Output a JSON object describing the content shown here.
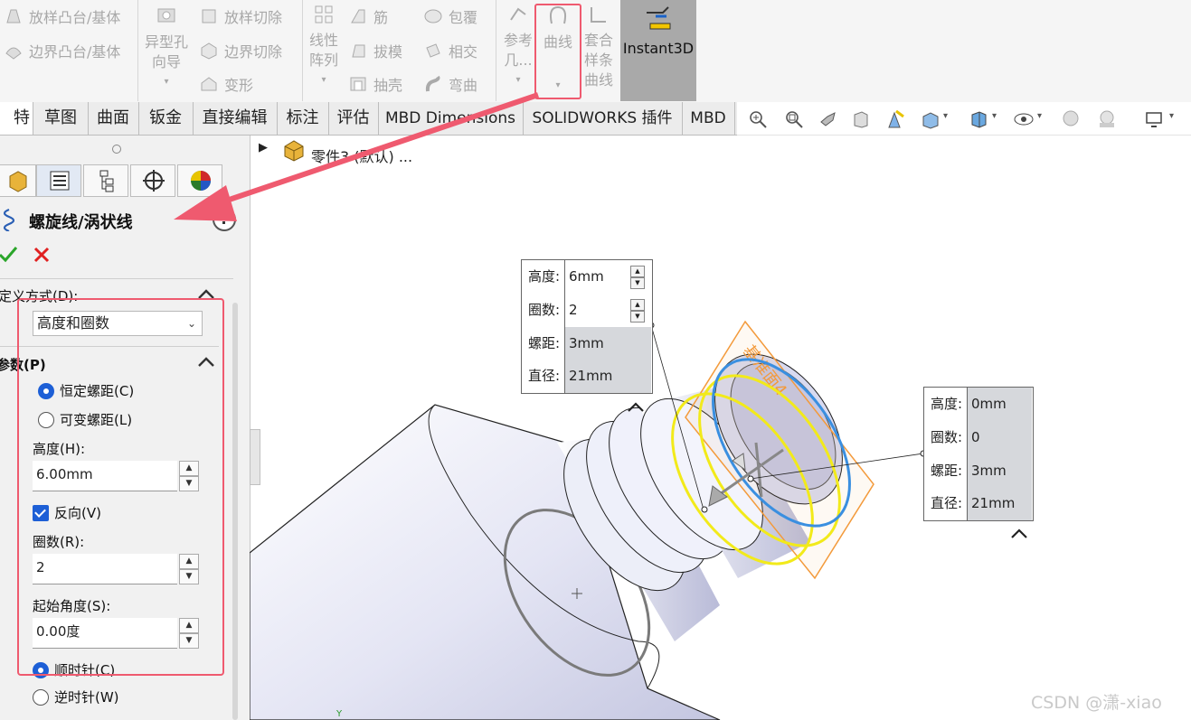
{
  "ribbon": {
    "loft_boss": "放样凸台/基体",
    "boundary_boss": "边界凸台/基体",
    "hole_wizard": [
      "异型孔",
      "向导"
    ],
    "loft_cut": "放样切除",
    "boundary_cut": "边界切除",
    "deform": "变形",
    "linear_pattern": [
      "线性",
      "阵列"
    ],
    "rib": "筋",
    "draft": "拔模",
    "shell": "抽壳",
    "wrap": "包覆",
    "intersect": "相交",
    "flex": "弯曲",
    "reference": [
      "参考",
      "几..."
    ],
    "curves": "曲线",
    "fit_spline": [
      "套合",
      "样条",
      "曲线"
    ],
    "instant3d": "Instant3D"
  },
  "tabs": [
    "特征",
    "草图",
    "曲面",
    "钣金",
    "直接编辑",
    "标注",
    "评估",
    "MBD Dimensions",
    "SOLIDWORKS 插件",
    "MBD"
  ],
  "tree_item": "零件3 (默认) ...",
  "panel": {
    "title": "螺旋线/涡状线",
    "help": "?",
    "define_by_label": "定义方式(D):",
    "define_by_value": "高度和圈数",
    "params_label": "参数(P)",
    "constant_pitch": "恒定螺距(C)",
    "variable_pitch": "可变螺距(L)",
    "height_label": "高度(H):",
    "height_value": "6.00mm",
    "reverse": "反向(V)",
    "revolutions_label": "圈数(R):",
    "revolutions_value": "2",
    "start_angle_label": "起始角度(S):",
    "start_angle_value": "0.00度",
    "clockwise": "顺时针(C)",
    "counterclockwise": "逆时针(W)"
  },
  "callout_left": {
    "rows": [
      {
        "label": "高度:",
        "value": "6mm"
      },
      {
        "label": "圈数:",
        "value": "2"
      },
      {
        "label": "螺距:",
        "value": "3mm"
      },
      {
        "label": "直径:",
        "value": "21mm"
      }
    ]
  },
  "callout_right": {
    "rows": [
      {
        "label": "高度:",
        "value": "0mm"
      },
      {
        "label": "圈数:",
        "value": "0"
      },
      {
        "label": "螺距:",
        "value": "3mm"
      },
      {
        "label": "直径:",
        "value": "21mm"
      }
    ]
  },
  "plane_label": "基准面4",
  "axis_label": "Y",
  "watermark": "CSDN @潇-xiao",
  "colors": {
    "highlight": "#ef5a6f",
    "helix_yellow": "#f2ea1a",
    "helix_blue": "#3a8fe0",
    "plane_orange": "#f39a3b",
    "accept_green": "#2aa52a",
    "cancel_red": "#e02020"
  }
}
